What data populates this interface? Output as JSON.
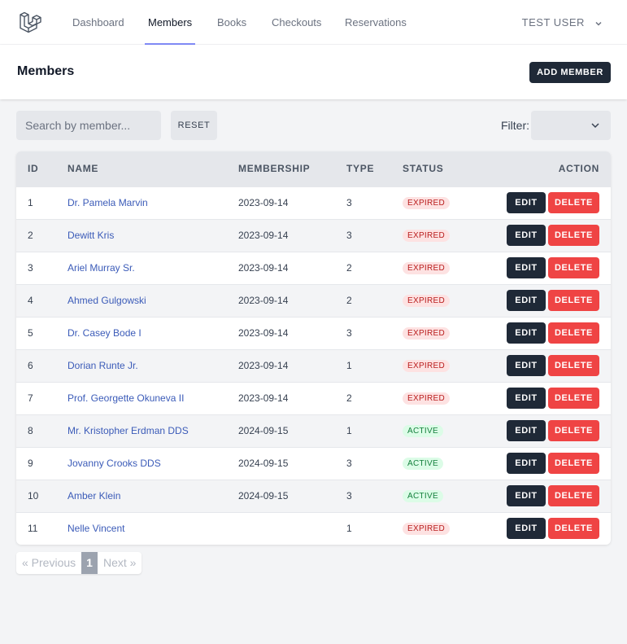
{
  "nav": {
    "items": [
      {
        "label": "Dashboard",
        "active": false
      },
      {
        "label": "Members",
        "active": true
      },
      {
        "label": "Books",
        "active": false
      },
      {
        "label": "Checkouts",
        "active": false
      },
      {
        "label": "Reservations",
        "active": false
      }
    ],
    "user": "TEST USER",
    "logo_icon": "laravel-logo-icon"
  },
  "header": {
    "title": "Members",
    "add_button": "ADD MEMBER"
  },
  "toolbar": {
    "search_placeholder": "Search by member...",
    "reset_label": "RESET",
    "filter_label": "Filter:",
    "filter_value": ""
  },
  "table": {
    "columns": [
      "ID",
      "NAME",
      "MEMBERSHIP",
      "TYPE",
      "STATUS",
      "ACTION"
    ],
    "edit_label": "EDIT",
    "delete_label": "DELETE",
    "rows": [
      {
        "id": "1",
        "name": "Dr. Pamela Marvin",
        "membership": "2023-09-14",
        "type": "3",
        "status": "EXPIRED"
      },
      {
        "id": "2",
        "name": "Dewitt Kris",
        "membership": "2023-09-14",
        "type": "3",
        "status": "EXPIRED"
      },
      {
        "id": "3",
        "name": "Ariel Murray Sr.",
        "membership": "2023-09-14",
        "type": "2",
        "status": "EXPIRED"
      },
      {
        "id": "4",
        "name": "Ahmed Gulgowski",
        "membership": "2023-09-14",
        "type": "2",
        "status": "EXPIRED"
      },
      {
        "id": "5",
        "name": "Dr. Casey Bode I",
        "membership": "2023-09-14",
        "type": "3",
        "status": "EXPIRED"
      },
      {
        "id": "6",
        "name": "Dorian Runte Jr.",
        "membership": "2023-09-14",
        "type": "1",
        "status": "EXPIRED"
      },
      {
        "id": "7",
        "name": "Prof. Georgette Okuneva II",
        "membership": "2023-09-14",
        "type": "2",
        "status": "EXPIRED"
      },
      {
        "id": "8",
        "name": "Mr. Kristopher Erdman DDS",
        "membership": "2024-09-15",
        "type": "1",
        "status": "ACTIVE"
      },
      {
        "id": "9",
        "name": "Jovanny Crooks DDS",
        "membership": "2024-09-15",
        "type": "3",
        "status": "ACTIVE"
      },
      {
        "id": "10",
        "name": "Amber Klein",
        "membership": "2024-09-15",
        "type": "3",
        "status": "ACTIVE"
      },
      {
        "id": "11",
        "name": "Nelle Vincent",
        "membership": "",
        "type": "1",
        "status": "EXPIRED"
      }
    ]
  },
  "pagination": {
    "prev": "« Previous",
    "current": "1",
    "next": "Next »"
  },
  "colors": {
    "primary_dark": "#1f2937",
    "danger": "#ef4444",
    "link": "#3b5bb8",
    "active_underline": "#818cf8"
  }
}
